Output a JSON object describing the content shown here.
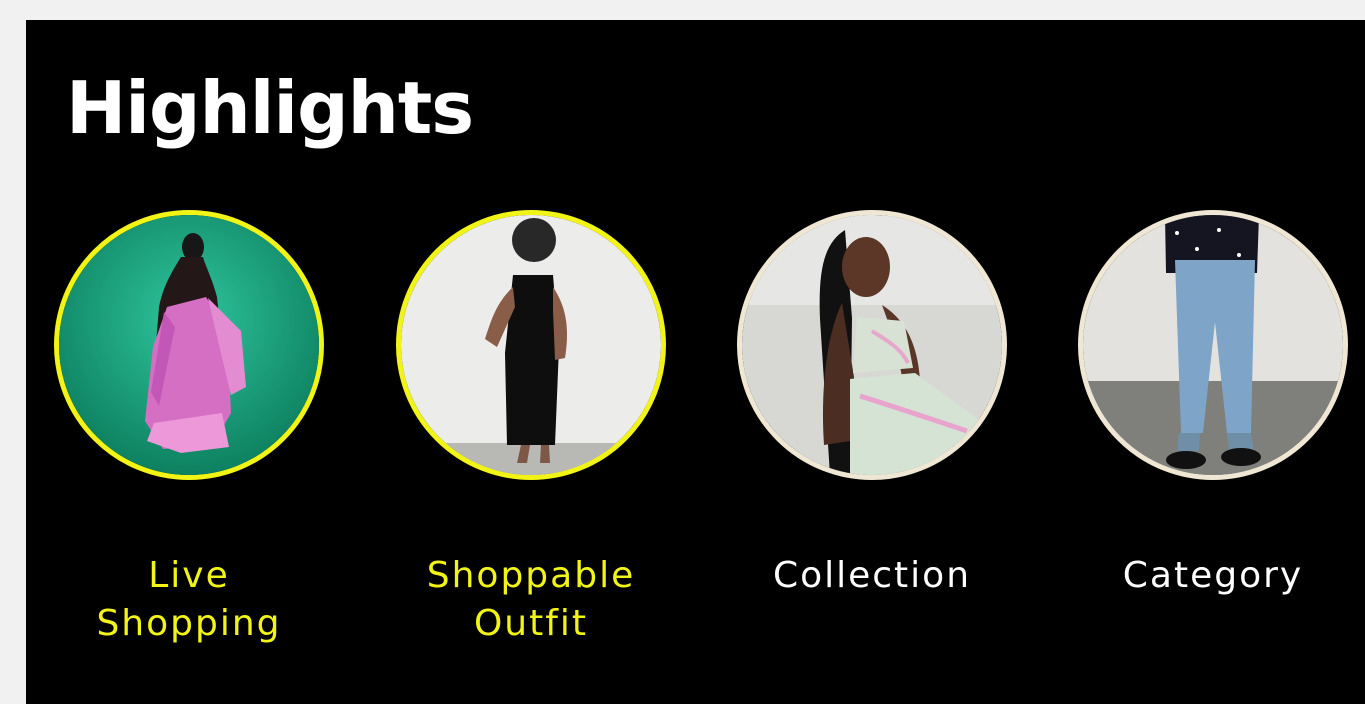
{
  "section": {
    "title": "Highlights"
  },
  "highlights": [
    {
      "label": "Live\nShopping",
      "status": "active",
      "accent": "#f1f414"
    },
    {
      "label": "Shoppable\nOutfit",
      "status": "active",
      "accent": "#f1f414"
    },
    {
      "label": "Collection",
      "status": "inactive",
      "accent": "#efe7d3"
    },
    {
      "label": "Category",
      "status": "inactive",
      "accent": "#efe7d3"
    }
  ],
  "colors": {
    "background": "#000000",
    "highlight_active": "#f1f414",
    "highlight_inactive": "#efe7d3",
    "title": "#ffffff"
  }
}
